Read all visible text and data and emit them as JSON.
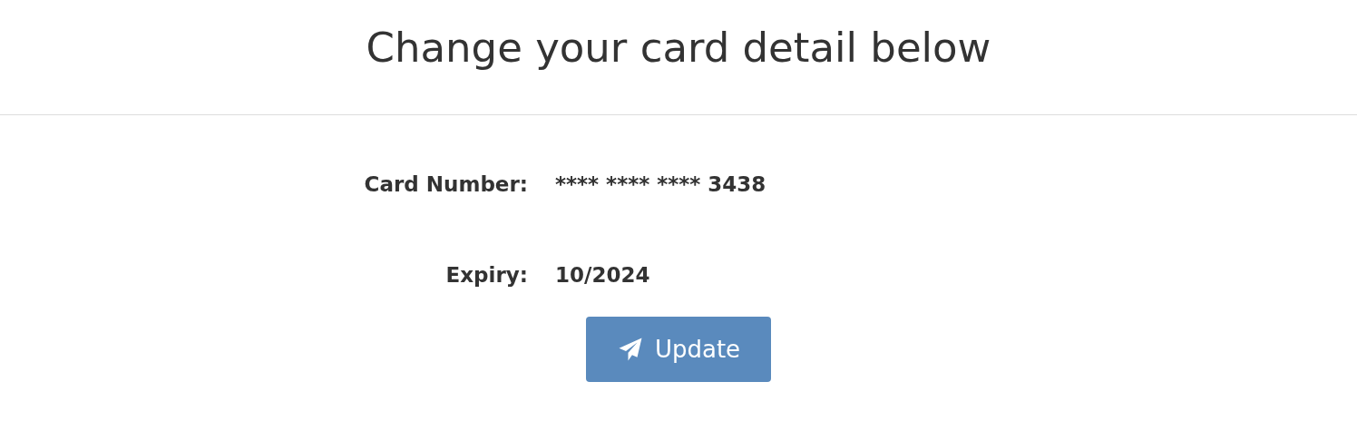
{
  "title": "Change your card detail below",
  "fields": [
    {
      "label": "Card Number:",
      "value": "**** **** **** 3438"
    },
    {
      "label": "Expiry:",
      "value": "10/2024"
    }
  ],
  "button": {
    "label": "Update"
  }
}
